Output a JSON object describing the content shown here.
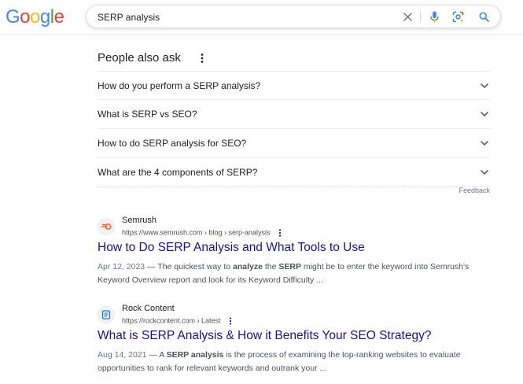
{
  "header": {
    "logo": {
      "letters": [
        "G",
        "o",
        "o",
        "g",
        "l",
        "e"
      ],
      "colors": [
        "#4285F4",
        "#EA4335",
        "#FBBC05",
        "#4285F4",
        "#34A853",
        "#EA4335"
      ]
    },
    "search": {
      "query": "SERP analysis"
    },
    "icons": [
      "close-icon",
      "microphone-icon",
      "lens-icon",
      "search-icon"
    ]
  },
  "paa": {
    "title": "People also ask",
    "questions": [
      "How do you perform a SERP analysis?",
      "What is SERP vs SEO?",
      "How to do SERP analysis for SEO?",
      "What are the 4 components of SERP?"
    ],
    "feedback": "Feedback"
  },
  "results": [
    {
      "site": "Semrush",
      "url": "https://www.semrush.com › blog › serp-analysis",
      "title": "How to Do SERP Analysis and What Tools to Use",
      "date": "Apr 12, 2023",
      "snippet_parts": [
        " — The quickest way to ",
        "analyze",
        " the ",
        "SERP",
        " might be to enter the keyword into Semrush's Keyword Overview report and look for its Keyword Difficulty ..."
      ],
      "favicon_color": "#FF642D"
    },
    {
      "site": "Rock Content",
      "url": "https://rockcontent.com › Latest",
      "title": "What is SERP Analysis & How it Benefits Your SEO Strategy?",
      "date": "Aug 14, 2021",
      "snippet_parts": [
        " — A ",
        "SERP analysis",
        " is the process of examining the top-ranking websites to evaluate opportunities to rank for relevant keywords and outrank your ..."
      ],
      "favicon_color": "#1A73E8"
    }
  ],
  "colors": {
    "link": "#1a0dab",
    "text": "#202124",
    "muted": "#4d5156"
  }
}
